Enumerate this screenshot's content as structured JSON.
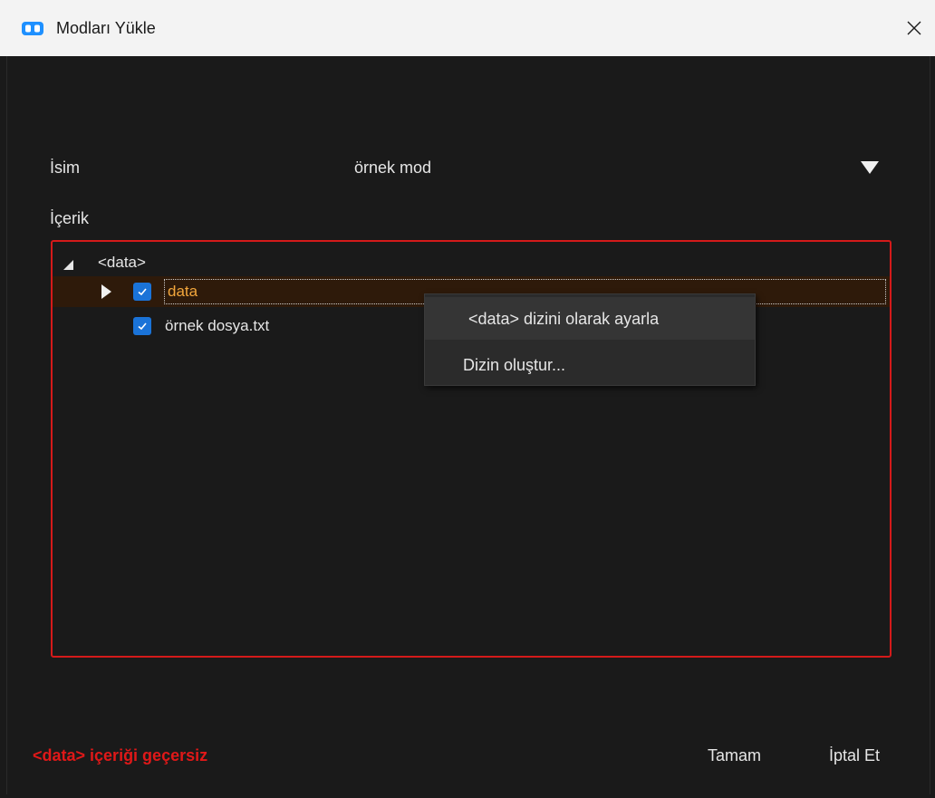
{
  "window": {
    "title": "Modları Yükle",
    "icon": "mod-loader-icon",
    "close_glyph": "✕"
  },
  "form": {
    "name_label": "İsim",
    "name_value": "örnek mod",
    "content_label": "İçerik"
  },
  "tree": {
    "root": "<data>",
    "items": [
      {
        "label": "data",
        "checked": true,
        "expandable": true,
        "selected": true
      },
      {
        "label": "örnek dosya.txt",
        "checked": true,
        "expandable": false,
        "selected": false
      }
    ]
  },
  "context_menu": {
    "items": [
      {
        "label": "<data> dizini olarak ayarla"
      },
      {
        "label": "Dizin oluştur..."
      }
    ]
  },
  "footer": {
    "error": "<data> içeriği geçersiz",
    "ok_label": "Tamam",
    "cancel_label": "İptal Et"
  },
  "colors": {
    "error": "#e01818",
    "border_error": "#d41a1a",
    "checkbox": "#1a73d8",
    "selection": "#2e1a0a",
    "background": "#1a1a1a"
  }
}
